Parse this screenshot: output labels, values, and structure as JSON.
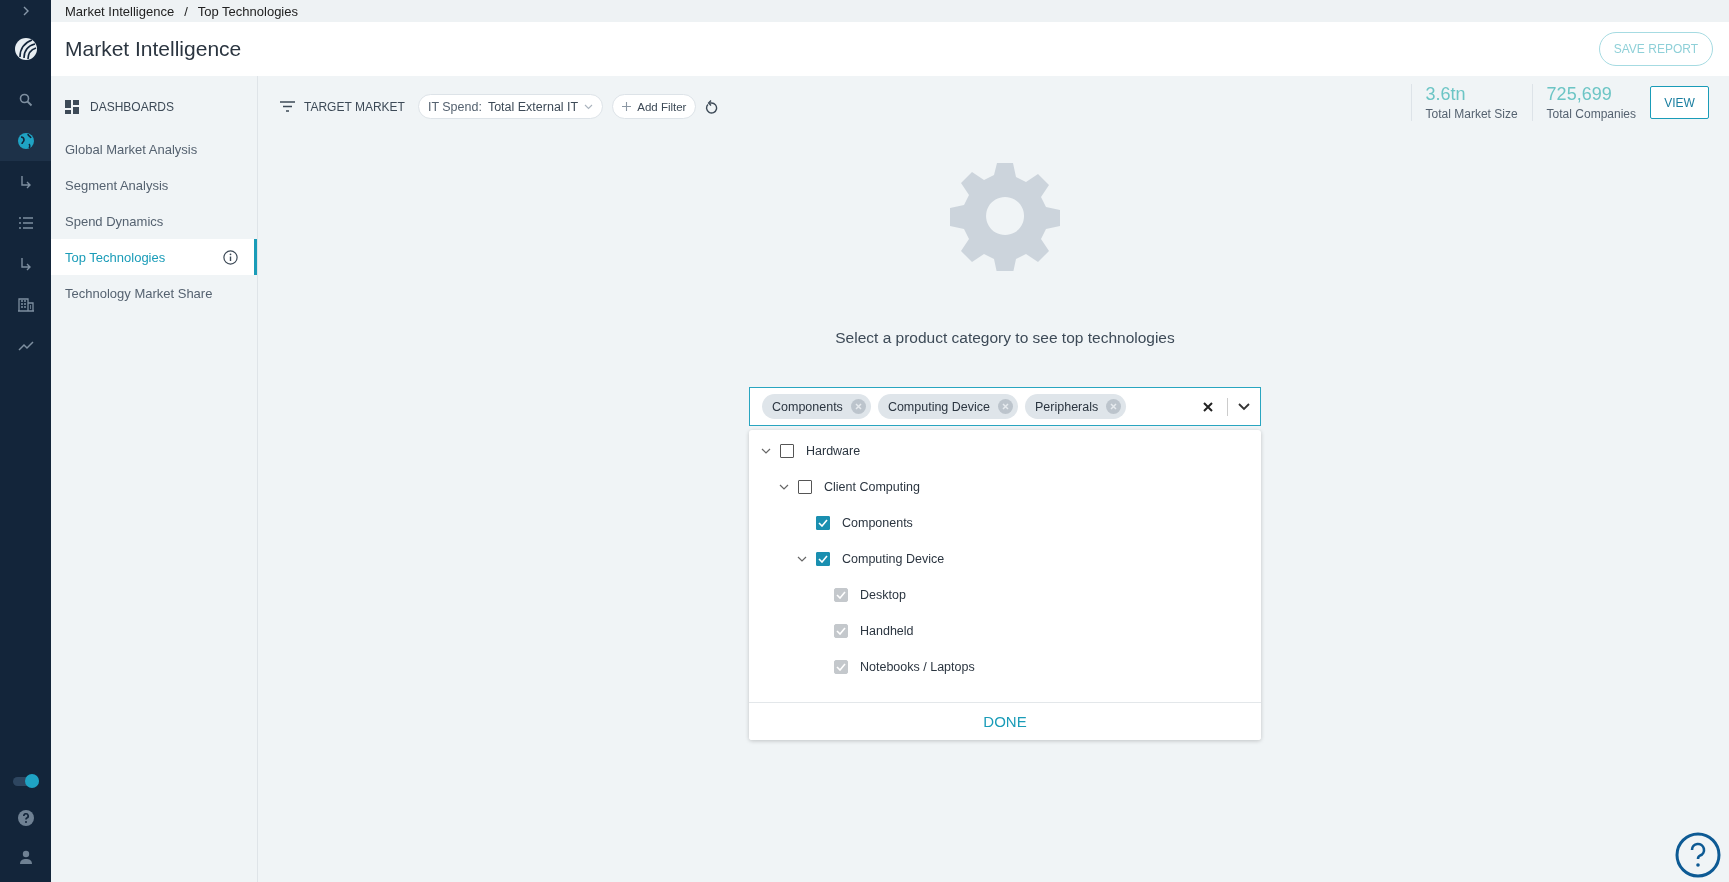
{
  "rail": {
    "items": [
      {
        "kind": "search",
        "selected": false
      },
      {
        "kind": "globe",
        "selected": true
      },
      {
        "kind": "sub",
        "selected": false
      },
      {
        "kind": "list",
        "selected": false
      },
      {
        "kind": "sub",
        "selected": false
      },
      {
        "kind": "building",
        "selected": false
      },
      {
        "kind": "trend",
        "selected": false
      }
    ],
    "toggle": {
      "on": true
    }
  },
  "breadcrumb": [
    "Market Intelligence",
    "Top Technologies"
  ],
  "breadcrumb_separator": "/",
  "page_title": "Market Intelligence",
  "save_button": "SAVE REPORT",
  "sidebar": {
    "heading": "DASHBOARDS",
    "items": [
      {
        "label": "Global Market Analysis",
        "selected": false
      },
      {
        "label": "Segment Analysis",
        "selected": false
      },
      {
        "label": "Spend Dynamics",
        "selected": false
      },
      {
        "label": "Top Technologies",
        "selected": true
      },
      {
        "label": "Technology Market Share",
        "selected": false
      }
    ]
  },
  "filter_bar": {
    "label": "TARGET MARKET",
    "filter_key": "IT Spend:",
    "filter_value": "Total External IT",
    "add_filter": "Add Filter"
  },
  "stats": [
    {
      "value": "3.6tn",
      "label": "Total Market Size"
    },
    {
      "value": "725,699",
      "label": "Total Companies"
    }
  ],
  "view_button": "VIEW",
  "prompt": "Select a product category to see top technologies",
  "select": {
    "chips": [
      "Components",
      "Computing Device",
      "Peripherals"
    ]
  },
  "tree": [
    {
      "label": "Hardware",
      "checked": false,
      "disabled": false,
      "children": [
        {
          "label": "Client Computing",
          "checked": false,
          "disabled": false,
          "children": [
            {
              "label": "Components",
              "checked": true,
              "disabled": false
            },
            {
              "label": "Computing Device",
              "checked": true,
              "disabled": false,
              "children": [
                {
                  "label": "Desktop",
                  "checked": true,
                  "disabled": true
                },
                {
                  "label": "Handheld",
                  "checked": true,
                  "disabled": true
                },
                {
                  "label": "Notebooks / Laptops",
                  "checked": true,
                  "disabled": true
                }
              ]
            }
          ]
        }
      ]
    }
  ],
  "done_button": "DONE"
}
